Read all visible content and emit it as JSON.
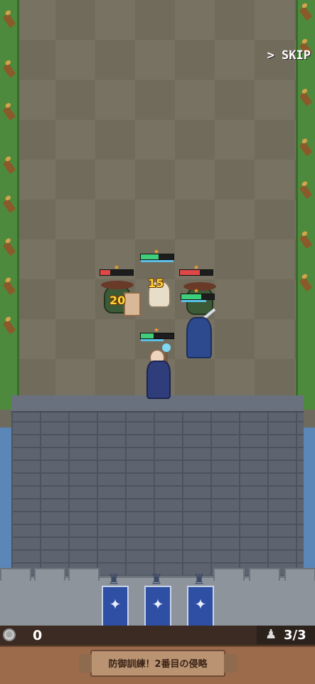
{
  "hud": {
    "skip_label": "> SKIP",
    "coins": "0",
    "units": "3/3",
    "stage_title": "防御訓練！2番目の侵略"
  },
  "icons": {
    "coin": "coin-icon",
    "units": "pawn-icon",
    "banner": "phoenix-crest-icon"
  },
  "battle": {
    "damage_numbers": [
      "15",
      "20"
    ],
    "units": [
      {
        "id": "goblin-left",
        "team": "enemy",
        "hp_pct": 30,
        "stars": 1
      },
      {
        "id": "white-knight",
        "team": "ally",
        "hp_pct": 55,
        "mana_pct": 100,
        "stars": 1
      },
      {
        "id": "goblin-right",
        "team": "enemy",
        "hp_pct": 60,
        "stars": 1
      },
      {
        "id": "blue-swordsman",
        "team": "ally",
        "hp_pct": 60,
        "mana_pct": 75,
        "stars": 1
      },
      {
        "id": "mage",
        "team": "ally",
        "hp_pct": 40,
        "mana_pct": 70,
        "stars": 1
      }
    ]
  },
  "colors": {
    "enemy_hp": "#e04848",
    "ally_hp": "#3fcf7a",
    "mana": "#5bc0e8",
    "banner": "#2e4fa3"
  }
}
